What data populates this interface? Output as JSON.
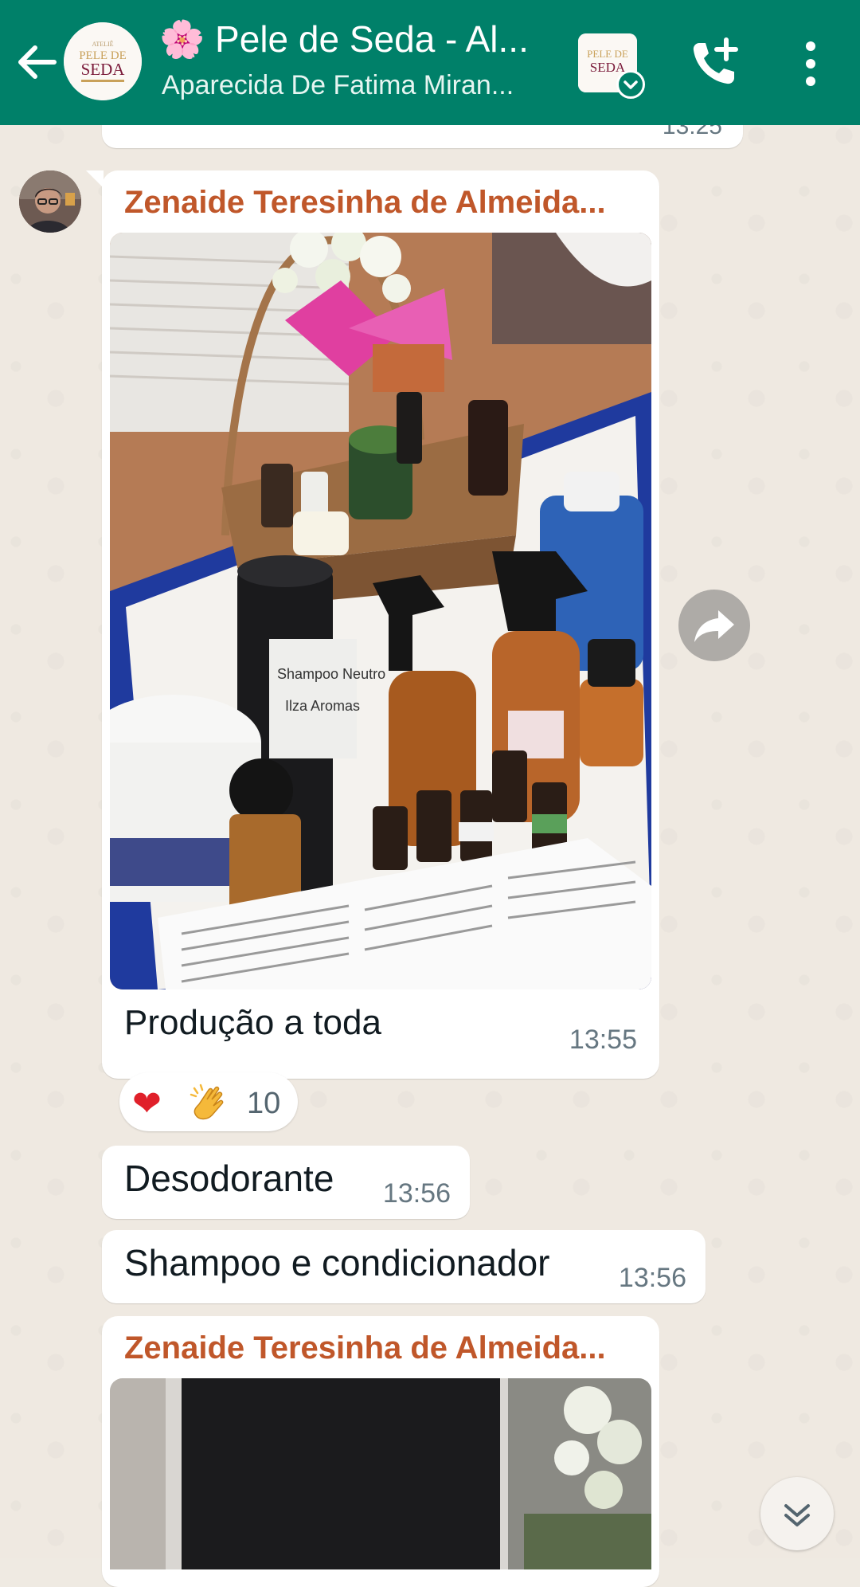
{
  "header": {
    "title": "🌸 Pele de Seda - Al...",
    "subtitle": "Aparecida De Fatima Miran...",
    "logo_text_line1": "PELE DE",
    "logo_text_line2": "SEDA",
    "background_color": "#008069"
  },
  "previous_message": {
    "time": "13:25"
  },
  "image_message": {
    "sender": "Zenaide Teresinha de Almeida...",
    "sender_color": "#c0572a",
    "caption": "Produção a toda",
    "time": "13:55",
    "photo_description_icon": "product-photo"
  },
  "reactions": {
    "emojis": [
      "❤️",
      "👏"
    ],
    "count": "10"
  },
  "messages": [
    {
      "text": "Desodorante",
      "time": "13:56"
    },
    {
      "text": "Shampoo e condicionador",
      "time": "13:56"
    }
  ],
  "image_message_2": {
    "sender": "Zenaide Teresinha de Almeida..."
  }
}
